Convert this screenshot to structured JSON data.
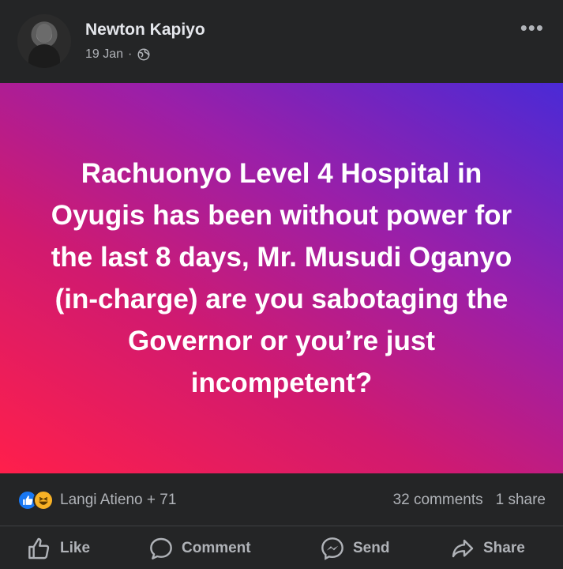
{
  "author": {
    "name": "Newton Kapiyo",
    "date": "19 Jan",
    "separator": "·"
  },
  "menu": {
    "icon": "more-options-icon",
    "glyph": "•••"
  },
  "post": {
    "text": "Rachuonyo Level 4 Hospital in Oyugis has been without power for the last 8 days, Mr. Musudi Oganyo (in-charge) are you sabotaging the Governor or you’re just incompetent?",
    "background_colors": [
      "#ff1f4b",
      "#9b1fa8",
      "#4a2ad6"
    ]
  },
  "stats": {
    "reactions_text": "Langi Atieno + 71",
    "comments": "32 comments",
    "shares": "1 share",
    "reaction_icons": [
      "like-icon",
      "haha-icon"
    ]
  },
  "actions": {
    "like": "Like",
    "comment": "Comment",
    "send": "Send",
    "share": "Share"
  },
  "colors": {
    "background": "#242526",
    "text": "#e4e6eb",
    "muted": "#b0b3b8",
    "like_blue": "#1877f2"
  }
}
